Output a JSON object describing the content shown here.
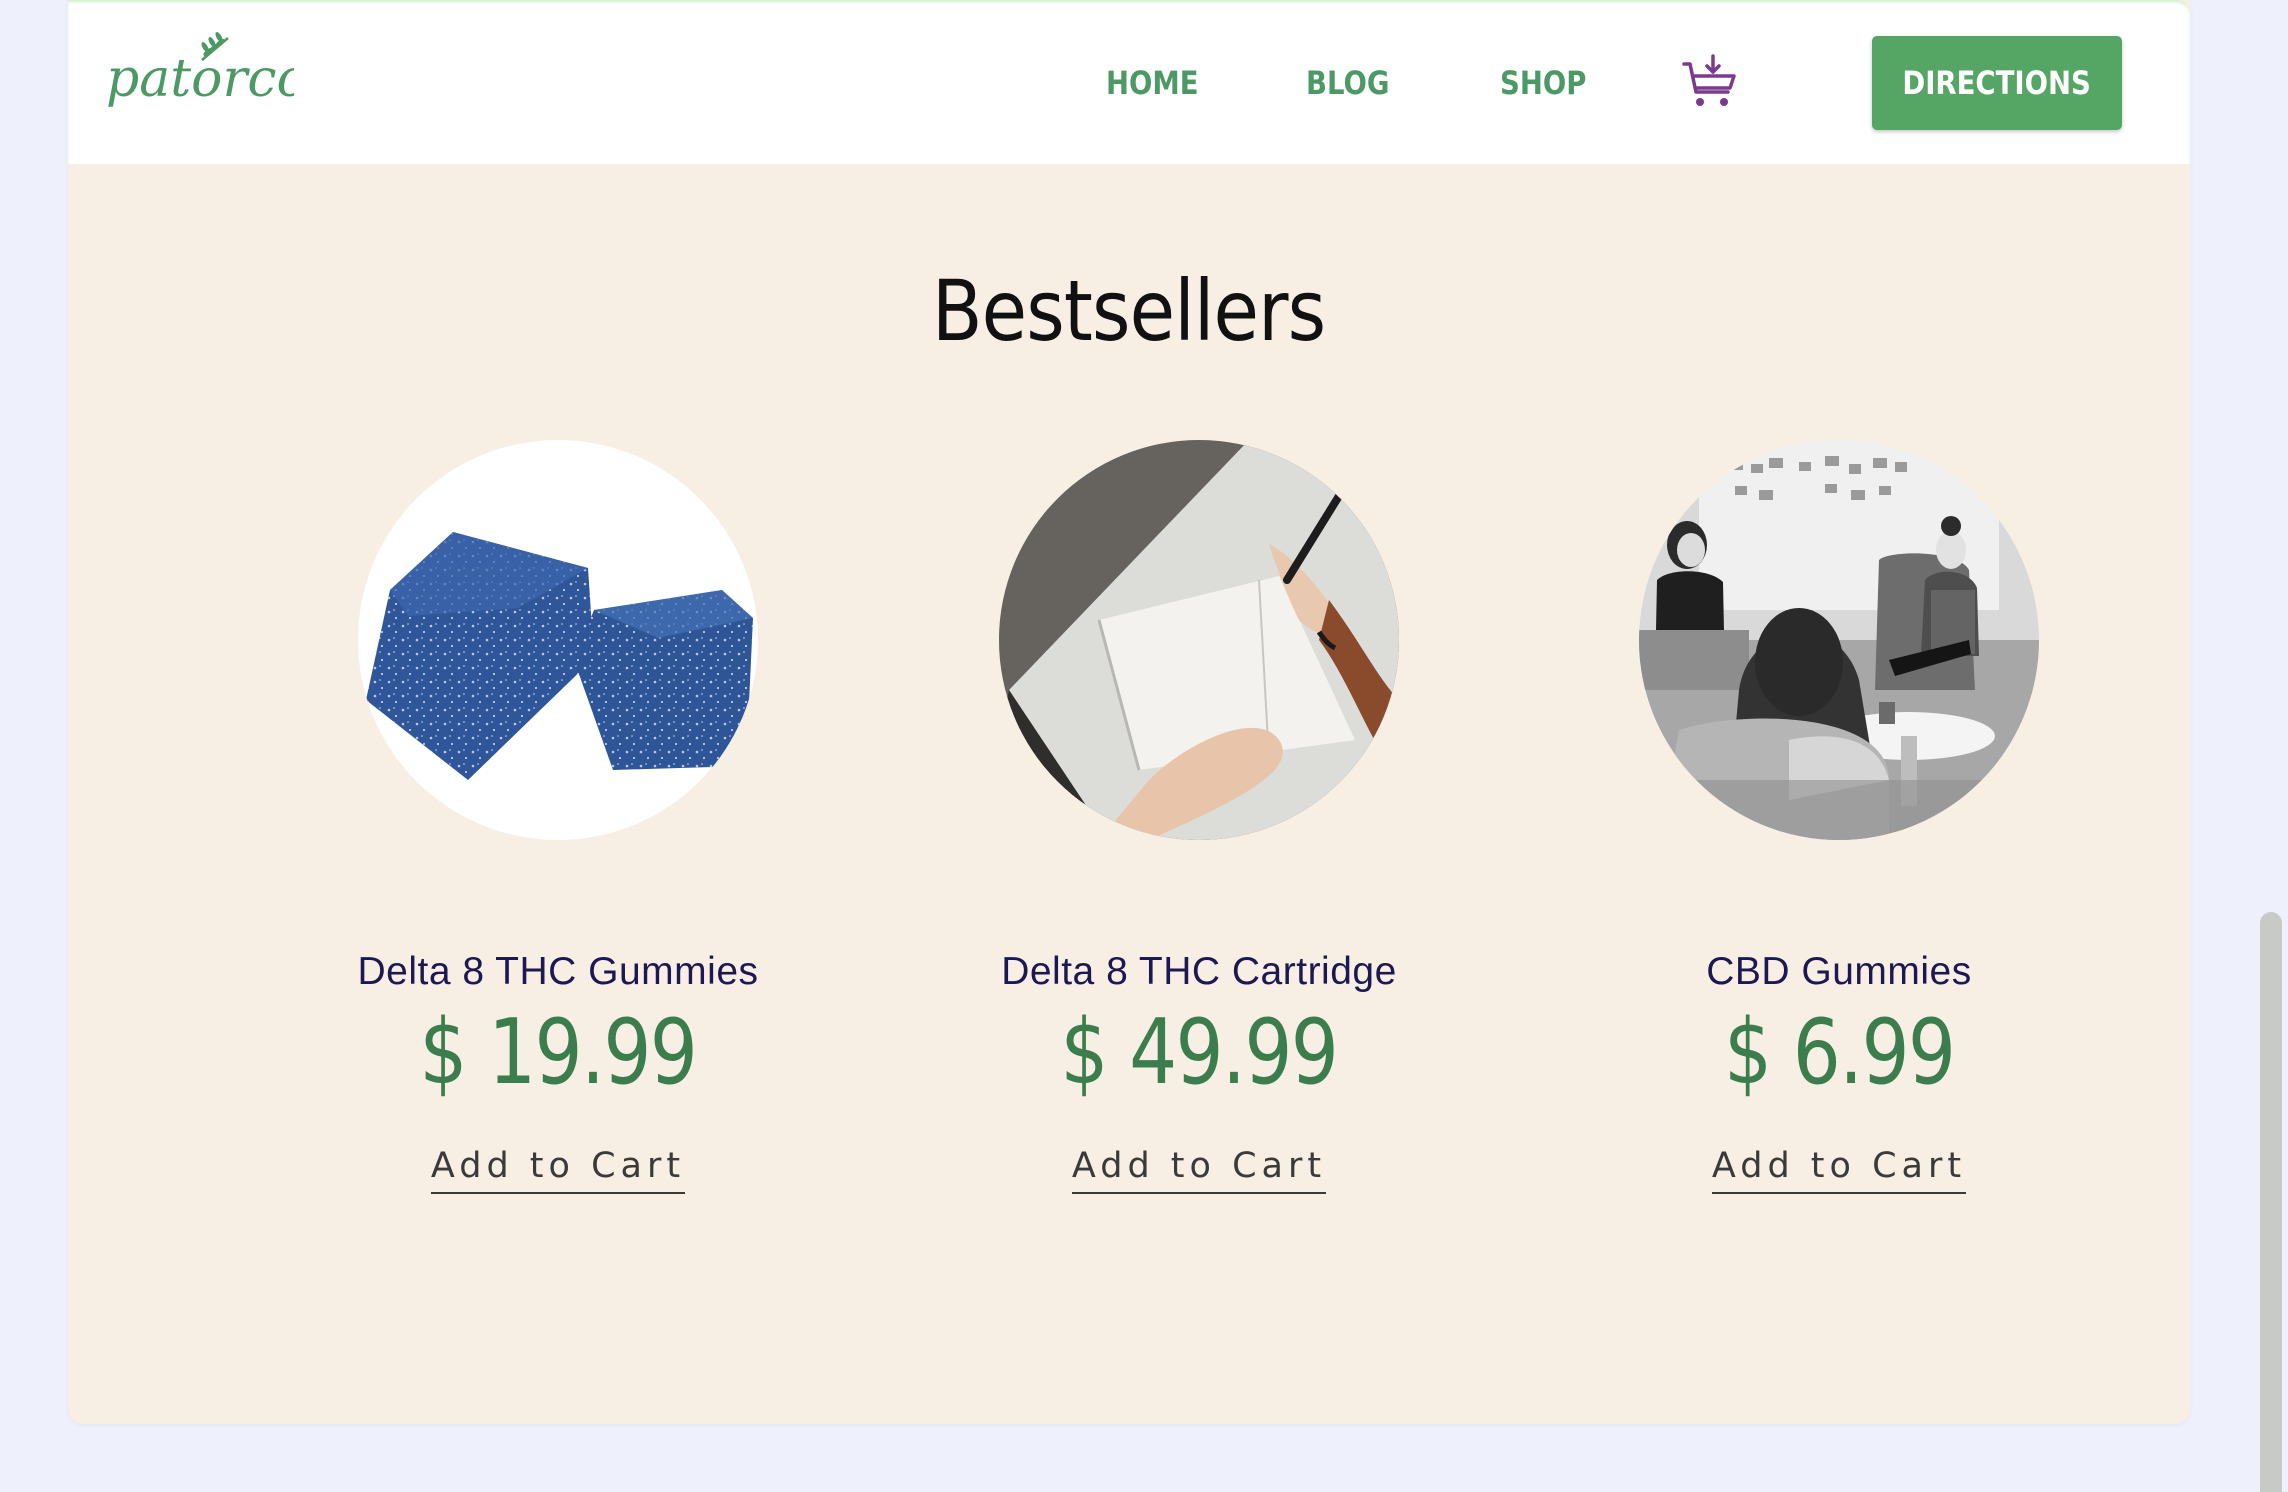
{
  "brand": {
    "logo_text": "patorco"
  },
  "nav": {
    "items": [
      {
        "label": "HOME"
      },
      {
        "label": "BLOG"
      },
      {
        "label": "SHOP"
      }
    ],
    "cart_icon": "cart-download-icon",
    "directions_label": "DIRECTIONS"
  },
  "section": {
    "title": "Bestsellers"
  },
  "products": [
    {
      "name": "Delta 8 THC Gummies",
      "price": "$ 19.99",
      "cta": "Add to Cart",
      "image": "blue-gummies-photo"
    },
    {
      "name": "Delta 8 THC Cartridge",
      "price": "$ 49.99",
      "cta": "Add to Cart",
      "image": "writing-in-notebook-photo"
    },
    {
      "name": "CBD Gummies",
      "price": "$ 6.99",
      "cta": "Add to Cart",
      "image": "group-meeting-photo"
    }
  ],
  "colors": {
    "accent_green": "#4d9965",
    "button_green": "#55a564",
    "price_green": "#3b7d4c",
    "cart_purple": "#7b3a8e",
    "section_bg": "#f7efe4",
    "product_name": "#1d1852"
  }
}
